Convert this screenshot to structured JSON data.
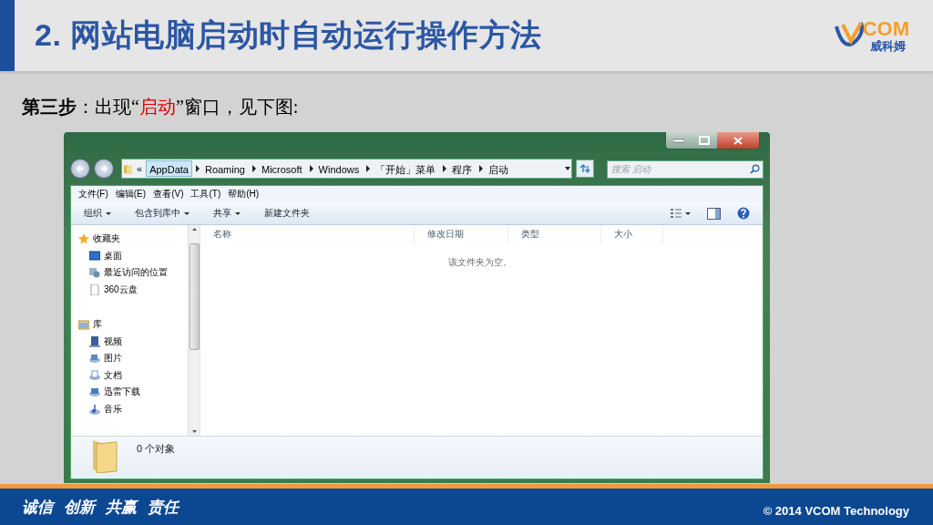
{
  "slide": {
    "title": "2. 网站电脑启动时自动运行操作方法",
    "logo": {
      "mark": "COM",
      "subtitle": "威科姆"
    }
  },
  "step": [
    {
      "text": "第三步",
      "highlight": false,
      "bold": true
    },
    {
      "text": "：出现“",
      "highlight": false,
      "bold": false
    },
    {
      "text": "启动",
      "highlight": true,
      "bold": false
    },
    {
      "text": "”窗口，见下图:",
      "highlight": false,
      "bold": false
    }
  ],
  "explorer": {
    "address": {
      "overflow": "«",
      "segments": [
        {
          "label": "AppData",
          "highlighted": true
        },
        {
          "label": "Roaming",
          "highlighted": false
        },
        {
          "label": "Microsoft",
          "highlighted": false
        },
        {
          "label": "Windows",
          "highlighted": false
        },
        {
          "label": "「开始」菜单",
          "highlighted": false
        },
        {
          "label": "程序",
          "highlighted": false
        },
        {
          "label": "启动",
          "highlighted": false
        }
      ]
    },
    "search": {
      "placeholder": "搜索 启动"
    },
    "menu": [
      "文件(F)",
      "编辑(E)",
      "查看(V)",
      "工具(T)",
      "帮助(H)"
    ],
    "toolbar": [
      {
        "label": "组织",
        "dropdown": true
      },
      {
        "label": "包含到库中",
        "dropdown": true
      },
      {
        "label": "共享",
        "dropdown": true
      },
      {
        "label": "新建文件夹",
        "dropdown": false
      }
    ],
    "nav": [
      {
        "label": "收藏夹",
        "children": [
          {
            "label": "桌面"
          },
          {
            "label": "最近访问的位置"
          },
          {
            "label": "360云盘"
          }
        ]
      },
      {
        "label": "库",
        "children": [
          {
            "label": "视频"
          },
          {
            "label": "图片"
          },
          {
            "label": "文档"
          },
          {
            "label": "迅雷下载"
          },
          {
            "label": "音乐"
          }
        ]
      }
    ],
    "columns": [
      "名称",
      "修改日期",
      "类型",
      "大小"
    ],
    "empty_message": "该文件夹为空。",
    "status": "0 个对象"
  },
  "footer": {
    "motto": [
      "诚信",
      "创新",
      "共赢",
      "责任"
    ],
    "copyright": "© 2014 VCOM Technology"
  }
}
